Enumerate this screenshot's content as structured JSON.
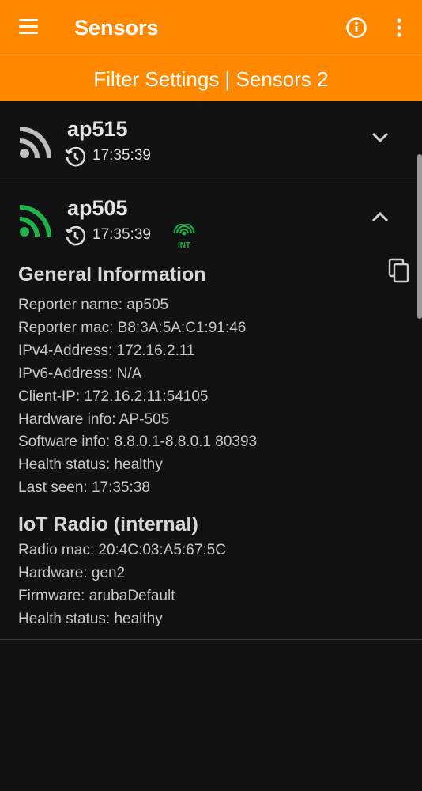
{
  "appbar": {
    "title": "Sensors",
    "menu_icon": "hamburger-menu-icon",
    "info_icon": "info-icon",
    "more_icon": "more-vert-icon"
  },
  "subbar": {
    "label": "Filter Settings | Sensors 2"
  },
  "colors": {
    "accent": "#ff8800",
    "background": "#121212",
    "signal_green": "#1fb24a",
    "signal_gray": "#bdbdbd"
  },
  "sensors": [
    {
      "name": "ap515",
      "time": "17:35:39",
      "status_icon": "wifi-signal-gray-icon",
      "expanded": false
    },
    {
      "name": "ap505",
      "time": "17:35:39",
      "status_icon": "wifi-signal-green-icon",
      "int_badge": "INT",
      "expanded": true,
      "general": {
        "title": "General Information",
        "lines": [
          "Reporter name: ap505",
          "Reporter mac: B8:3A:5A:C1:91:46",
          "IPv4-Address: 172.16.2.11",
          "IPv6-Address: N/A",
          "Client-IP: 172.16.2.11:54105",
          "Hardware info: AP-505",
          "Software info: 8.8.0.1-8.8.0.1 80393",
          "Health status: healthy",
          "Last seen: 17:35:38"
        ]
      },
      "iot": {
        "title": "IoT Radio (internal)",
        "lines": [
          "Radio mac: 20:4C:03:A5:67:5C",
          "Hardware: gen2",
          "Firmware: arubaDefault",
          "Health status: healthy"
        ]
      }
    }
  ]
}
